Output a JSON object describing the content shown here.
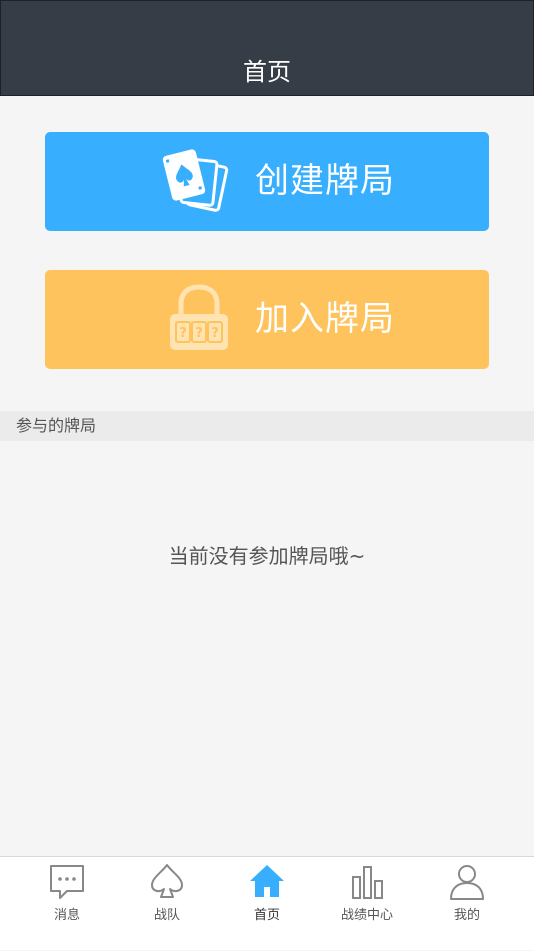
{
  "header": {
    "title": "首页"
  },
  "actions": {
    "create": {
      "label": "创建牌局",
      "icon": "playing-cards-icon",
      "color": "#38aefe"
    },
    "join": {
      "label": "加入牌局",
      "icon": "lock-icon",
      "lock_text": "???",
      "color": "#fec35c"
    }
  },
  "section": {
    "title": "参与的牌局"
  },
  "empty": {
    "message": "当前没有参加牌局哦~"
  },
  "tabbar": {
    "tabs": [
      {
        "label": "消息",
        "icon": "chat-icon",
        "active": false
      },
      {
        "label": "战队",
        "icon": "spade-icon",
        "active": false
      },
      {
        "label": "首页",
        "icon": "home-icon",
        "active": true
      },
      {
        "label": "战绩中心",
        "icon": "bar-chart-icon",
        "active": false
      },
      {
        "label": "我的",
        "icon": "user-icon",
        "active": false
      }
    ],
    "active_color": "#38aefe"
  }
}
